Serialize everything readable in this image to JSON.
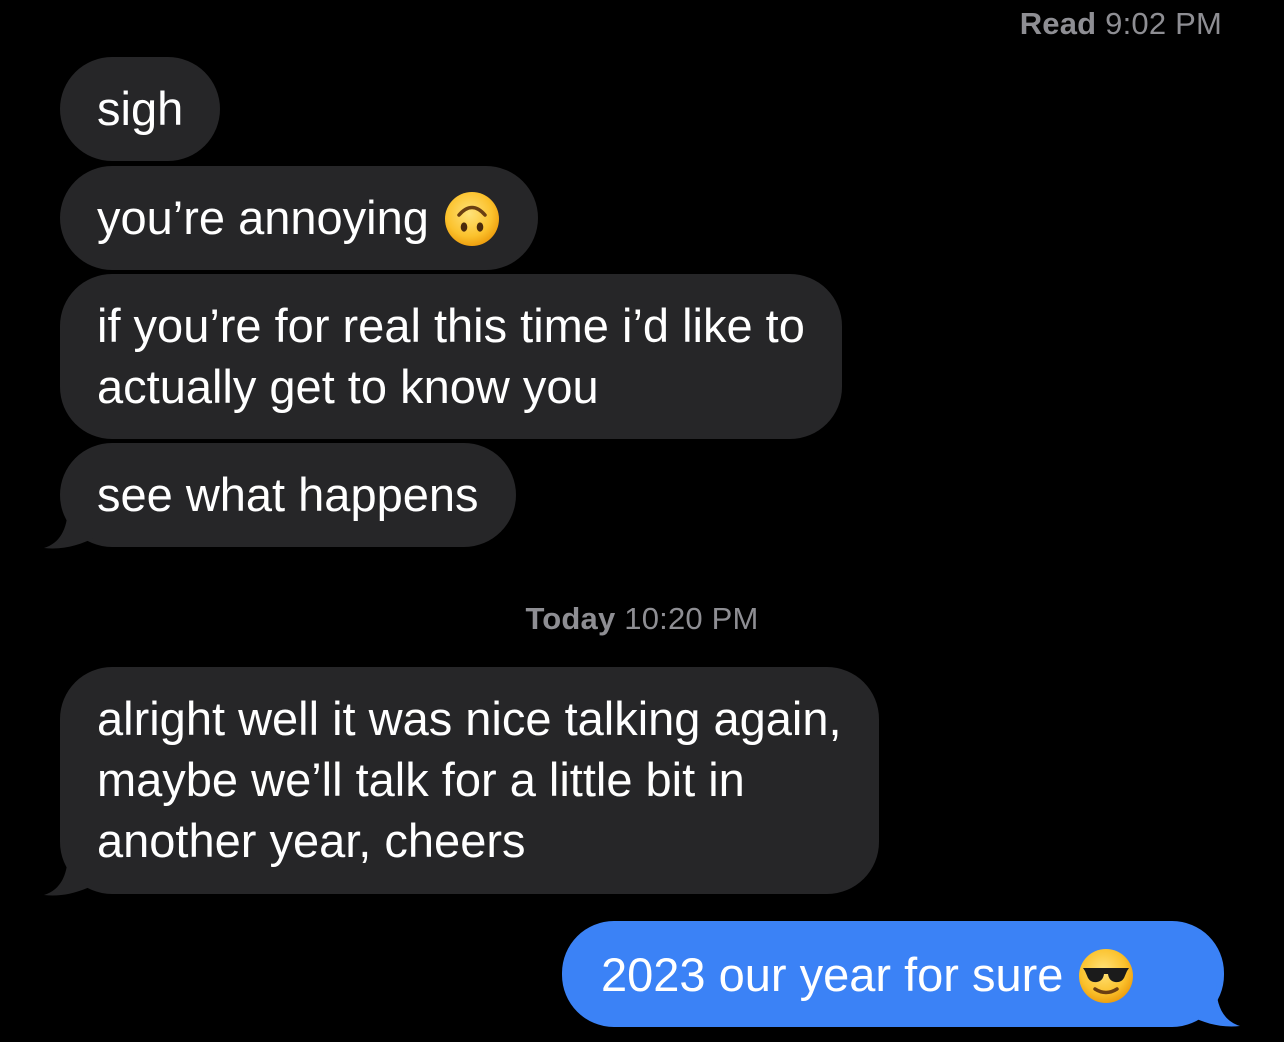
{
  "conversation": {
    "read_receipt": {
      "label": "Read",
      "time": "9:02 PM"
    },
    "timestamp": {
      "day": "Today",
      "time": "10:20 PM"
    },
    "messages": [
      {
        "direction": "incoming",
        "lines": [
          "sigh"
        ]
      },
      {
        "direction": "incoming",
        "lines": [
          "you’re annoying"
        ],
        "emoji": "upside-down-face-icon"
      },
      {
        "direction": "incoming",
        "lines": [
          "if you’re for real this time i’d like to",
          "actually get to know you"
        ]
      },
      {
        "direction": "incoming",
        "lines": [
          "see what happens"
        ]
      },
      {
        "direction": "incoming",
        "lines": [
          "alright well it was nice talking again,",
          "maybe we’ll talk for a little bit in",
          "another year, cheers"
        ]
      },
      {
        "direction": "outgoing",
        "lines": [
          "2023 our year for sure"
        ],
        "emoji": "sunglasses-face-icon"
      }
    ]
  },
  "colors": {
    "background": "#000000",
    "incoming_bubble": "#262628",
    "outgoing_bubble": "#3b82f6",
    "meta_text": "#8e8e93",
    "message_text": "#ffffff"
  }
}
